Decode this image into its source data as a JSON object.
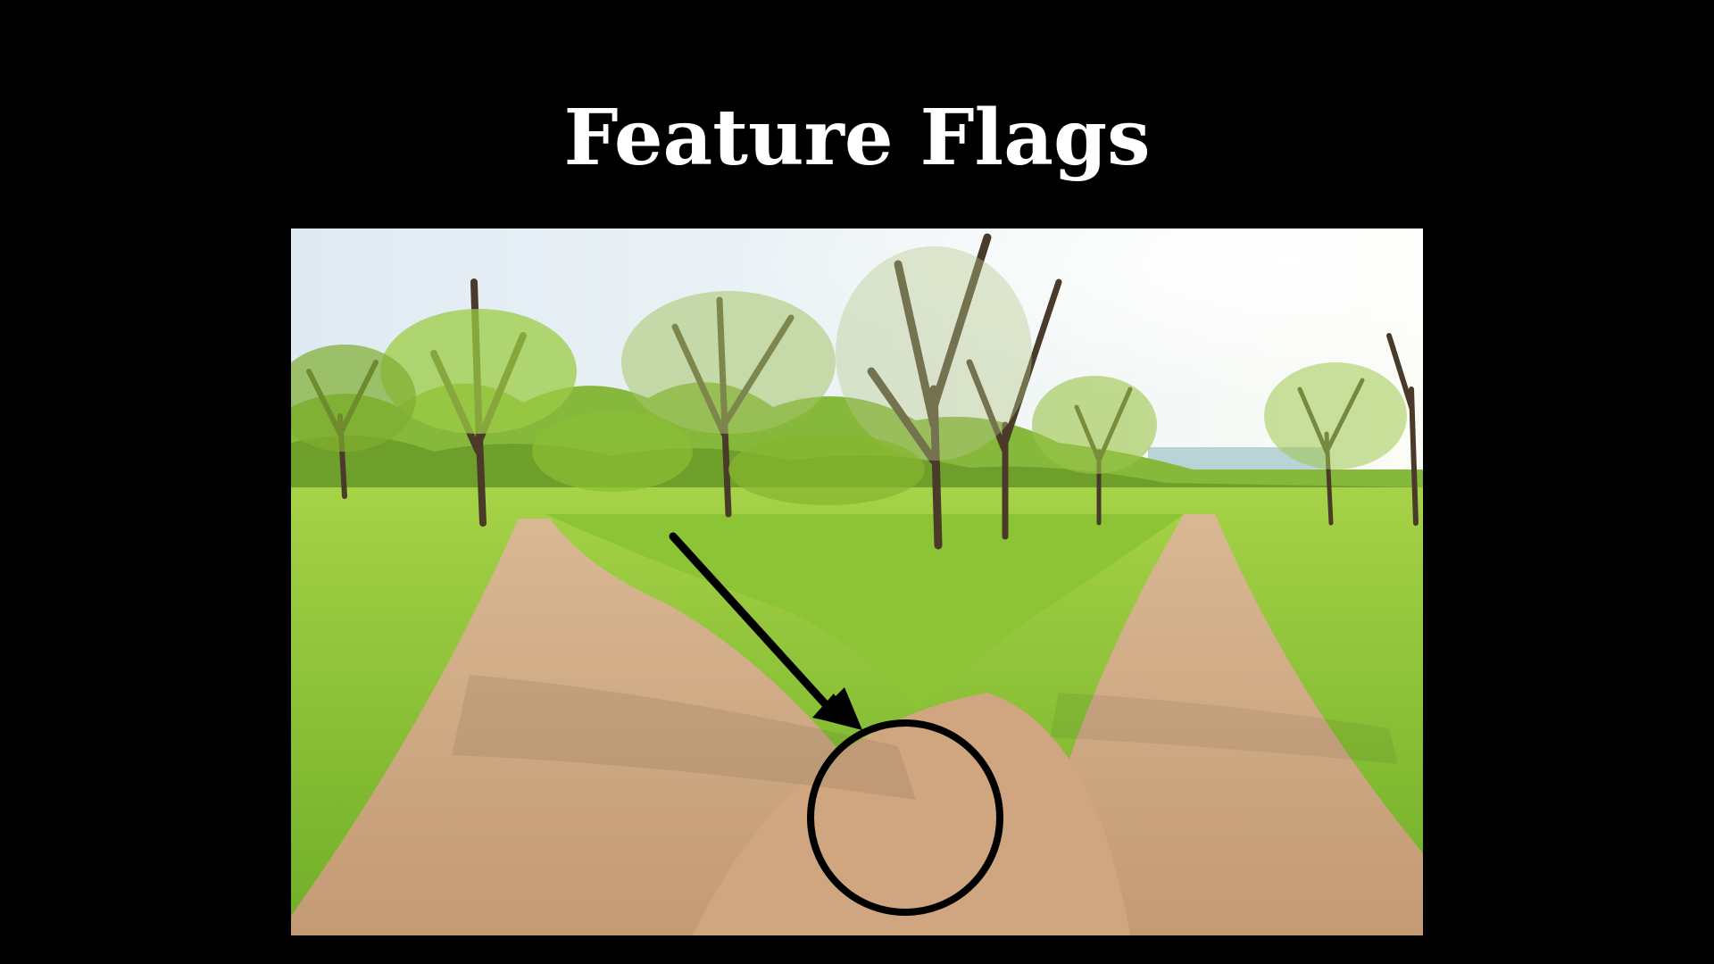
{
  "slide": {
    "title": "Feature Flags"
  },
  "photo": {
    "description_icon": "fork-in-road-photo",
    "sky_color": "#eef4f6",
    "grass_color": "#8fc93a",
    "path_color": "#c9a27c"
  },
  "annotations": {
    "arrow_icon": "arrow-icon",
    "circle_icon": "circle-highlight-icon",
    "stroke_color": "#000000"
  }
}
